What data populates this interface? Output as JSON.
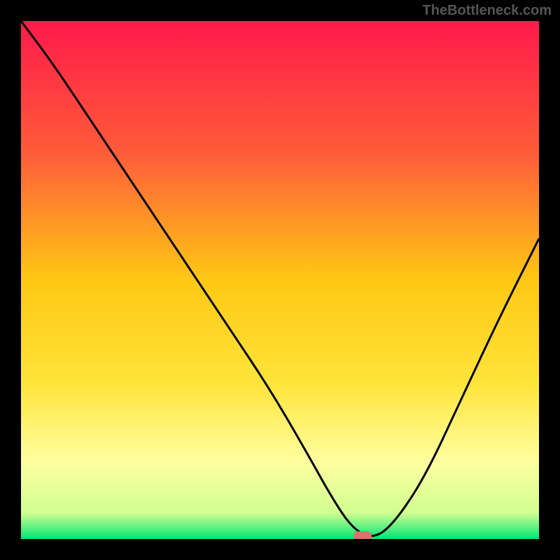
{
  "watermark": "TheBottleneck.com",
  "chart_data": {
    "type": "line",
    "title": "",
    "xlabel": "",
    "ylabel": "",
    "xlim": [
      0,
      100
    ],
    "ylim": [
      0,
      100
    ],
    "gradient_stops": [
      {
        "offset": 0,
        "color": "#ff1a4a"
      },
      {
        "offset": 25,
        "color": "#ff5a3a"
      },
      {
        "offset": 50,
        "color": "#ffc814"
      },
      {
        "offset": 70,
        "color": "#ffe43a"
      },
      {
        "offset": 85,
        "color": "#ffffa0"
      },
      {
        "offset": 95,
        "color": "#d0ff90"
      },
      {
        "offset": 100,
        "color": "#00e676"
      }
    ],
    "series": [
      {
        "name": "bottleneck-curve",
        "x": [
          0,
          6,
          14,
          24,
          32,
          40,
          48,
          55,
          60,
          64,
          68,
          72,
          78,
          85,
          92,
          100
        ],
        "y": [
          100,
          92,
          80,
          65,
          53,
          41,
          29,
          17,
          8,
          2,
          0,
          3,
          12,
          27,
          42,
          58
        ]
      }
    ],
    "marker": {
      "x": 66,
      "y": 0.5,
      "color": "#d9736b"
    }
  }
}
